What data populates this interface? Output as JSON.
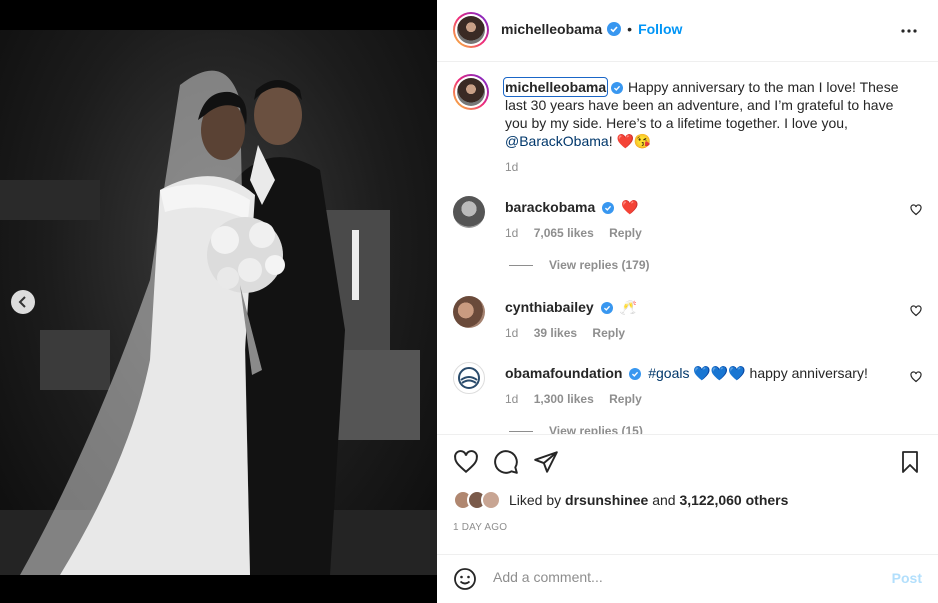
{
  "post": {
    "author": "michelleobama",
    "follow_label": "Follow",
    "separator": "•"
  },
  "caption": {
    "author": "michelleobama",
    "text": "Happy anniversary to the man I love! These last 30 years have been an adventure, and I’m grateful to have you by my side. Here’s to a lifetime together. I love you,",
    "mention": "@BarackObama",
    "suffix": "! ❤️😘",
    "time": "1d"
  },
  "comments": [
    {
      "author": "barackobama",
      "text": "❤️",
      "time": "1d",
      "likes": "7,065 likes",
      "reply": "Reply",
      "view_replies": "View replies (179)"
    },
    {
      "author": "cynthiabailey",
      "text": "🥂",
      "time": "1d",
      "likes": "39 likes",
      "reply": "Reply"
    },
    {
      "author": "obamafoundation",
      "hashtag": "#goals",
      "text": "💙💙💙 happy anniversary!",
      "time": "1d",
      "likes": "1,300 likes",
      "reply": "Reply",
      "view_replies": "View replies (15)"
    }
  ],
  "likes": {
    "prefix": "Liked by",
    "user": "drsunshinee",
    "and": "and",
    "count": "3,122,060 others"
  },
  "age": "1 DAY AGO",
  "composer": {
    "placeholder": "Add a comment...",
    "post_label": "Post"
  },
  "colors": {
    "accent": "#0095f6",
    "verified": "#3897f0",
    "post_disabled": "#b2dffc"
  }
}
